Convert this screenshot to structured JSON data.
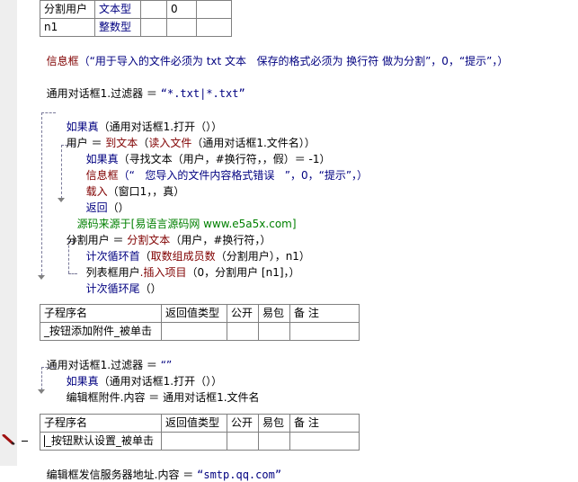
{
  "var_table": {
    "rows": [
      {
        "name": "分割用户",
        "type": "文本型",
        "c3": "",
        "c4": "0",
        "c5": ""
      },
      {
        "name": "n1",
        "type": "整数型",
        "c3": "",
        "c4": "",
        "c5": ""
      }
    ]
  },
  "code": {
    "l1_cmd": "信息框",
    "l1_args": "（“用于导入的文件必须为 txt 文本   保存的格式必须为 换行符 做为分割”，0，“提示”，）",
    "l2_obj": "通用对话框1",
    "l2_prop": ".过滤器",
    "l2_eq": " ＝ ",
    "l2_val": "“*.txt|*.txt”",
    "l3_cmd": "如果真",
    "l3_args": "（通用对话框1.打开（））",
    "l4_var": "用户",
    "l4_eq": " ＝ ",
    "l4_f1": "到文本",
    "l4_p1": "（",
    "l4_f2": "读入文件",
    "l4_p2": "（通用对话框1.文件名））",
    "l5_cmd": "如果真",
    "l5_args": "（寻找文本（用户，#换行符，，假）＝ -1）",
    "l6_cmd": "信息框",
    "l6_args": "（“   您导入的文件内容格式错误   ”，0，“提示”，）",
    "l7_cmd": "载入",
    "l7_args": "（窗口1，，真）",
    "l8_cmd": "返回",
    "l8_args": "（）",
    "l9_comment": "源码来源于[易语言源码网 www.e5a5x.com]",
    "l10_var": "分割用户",
    "l10_eq": " ＝ ",
    "l10_f": "分割文本",
    "l10_args": "（用户，#换行符，）",
    "l11_cmd": "计次循环首",
    "l11_p": "（",
    "l11_f": "取数组成员数",
    "l11_args": "（分割用户），n1）",
    "l12_obj": "列表框用户",
    "l12_method": ".插入项目",
    "l12_args": "（0，分割用户 [n1]，）",
    "l13_cmd": "计次循环尾",
    "l13_args": "（）"
  },
  "sub1": {
    "headers": [
      "子程序名",
      "返回值类型",
      "公开",
      "易包",
      "备 注"
    ],
    "name": "_按钮添加附件_被单击"
  },
  "sub1_code": {
    "l1_obj": "通用对话框1",
    "l1_prop": ".过滤器",
    "l1_eq": " ＝ ",
    "l1_val": "“”",
    "l2_cmd": "如果真",
    "l2_args": "（通用对话框1.打开（））",
    "l3_text": "编辑框附件.内容 ＝ 通用对话框1.文件名"
  },
  "sub2": {
    "headers": [
      "子程序名",
      "返回值类型",
      "公开",
      "易包",
      "备 注"
    ],
    "name": "_按钮默认设置_被单击"
  },
  "sub2_code": {
    "l1_obj": "编辑框发信服务器地址",
    "l1_prop": ".内容",
    "l1_eq": " ＝ ",
    "l1_val": "“smtp.qq.com”"
  },
  "colors": {
    "command": "#800000",
    "keyword": "#000080",
    "comment": "#008000",
    "string": "#000080",
    "gutter": "#eeeeee"
  }
}
